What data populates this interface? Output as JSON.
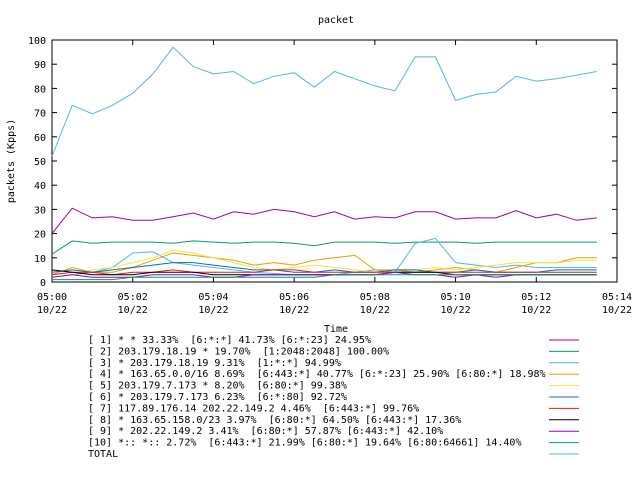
{
  "chart_data": {
    "type": "line",
    "title": "packet",
    "xlabel": "Time",
    "ylabel": "packets (Kpps)",
    "ylim": [
      0,
      100
    ],
    "y_ticks": [
      "0",
      "10",
      "20",
      "30",
      "40",
      "50",
      "60",
      "70",
      "80",
      "90",
      "100"
    ],
    "x_ticks": [
      {
        "time": "05:00",
        "date": "10/22"
      },
      {
        "time": "05:02",
        "date": "10/22"
      },
      {
        "time": "05:04",
        "date": "10/22"
      },
      {
        "time": "05:06",
        "date": "10/22"
      },
      {
        "time": "05:08",
        "date": "10/22"
      },
      {
        "time": "05:10",
        "date": "10/22"
      },
      {
        "time": "05:12",
        "date": "10/22"
      },
      {
        "time": "05:14",
        "date": "10/22"
      }
    ],
    "x": [
      "05:00",
      "05:00:30",
      "05:01",
      "05:01:30",
      "05:02",
      "05:02:30",
      "05:03",
      "05:03:30",
      "05:04",
      "05:04:30",
      "05:05",
      "05:05:30",
      "05:06",
      "05:06:30",
      "05:07",
      "05:07:30",
      "05:08",
      "05:08:30",
      "05:09",
      "05:09:30",
      "05:10",
      "05:10:30",
      "05:11",
      "05:11:30",
      "05:12",
      "05:12:30",
      "05:13",
      "05:13:30"
    ],
    "grid": false,
    "legend_position": "bottom",
    "series": [
      {
        "name": "[ 1] * * 33.33%  [6:*:*] 41.73% [6:*:23] 24.95%",
        "color": "#a000a0",
        "values": [
          20,
          30.5,
          26.5,
          27,
          25.5,
          25.5,
          27,
          28.5,
          26,
          29,
          28,
          30,
          29,
          27,
          29,
          26,
          27,
          26.5,
          29,
          29,
          26,
          26.5,
          26.5,
          29.5,
          26.5,
          28,
          25.5,
          26.5
        ]
      },
      {
        "name": "[ 2] 203.179.18.19 * 19.70%  [1:2048:2048] 100.00%",
        "color": "#00a060",
        "values": [
          11.5,
          17,
          16,
          16.5,
          16.5,
          16.5,
          16,
          17,
          16.5,
          16,
          16.5,
          16.5,
          16,
          15,
          16.5,
          16.5,
          16.5,
          16,
          16.5,
          16.5,
          16.5,
          16,
          16.5,
          16.5,
          16.5,
          16.5,
          16.5,
          16.5
        ]
      },
      {
        "name": "[ 3] * 203.179.18.19 9.31%  [1:*:*] 94.99%",
        "color": "#56b4e9",
        "values": [
          2,
          3,
          4,
          6,
          12,
          12.5,
          8,
          7,
          6,
          5,
          4,
          3.5,
          3,
          3,
          3,
          4,
          5,
          4,
          16,
          18,
          8,
          7,
          6,
          7,
          6,
          6,
          6,
          6
        ]
      },
      {
        "name": "[ 4] * 163.65.0.0/16 8.69%  [6:443:*] 40.77% [6:*:23] 25.90% [6:80:*] 18.98%",
        "color": "#e69f00",
        "values": [
          3,
          6,
          4,
          4,
          6,
          9,
          12,
          11,
          10,
          9,
          7,
          8,
          7,
          9,
          10,
          11,
          5,
          5,
          4,
          5,
          6,
          5,
          4,
          6,
          8,
          8,
          10,
          10
        ]
      },
      {
        "name": "[ 5] 203.179.7.173 * 8.20%  [6:80:*] 99.38%",
        "color": "#f0e442",
        "values": [
          2,
          3,
          5,
          6,
          8,
          10,
          13,
          12,
          10,
          8,
          6,
          5,
          6,
          7,
          6,
          5,
          4,
          5,
          5,
          6,
          5,
          6,
          7,
          8,
          8,
          8,
          9,
          9
        ]
      },
      {
        "name": "[ 6] * 203.179.7.173 6.23%  [6:*:80] 92.72%",
        "color": "#0072b2",
        "values": [
          4,
          5,
          4,
          5,
          6,
          7,
          8,
          8,
          7,
          6,
          5,
          5,
          4,
          4,
          5,
          4,
          4,
          5,
          5,
          4,
          4,
          5,
          4,
          4,
          4,
          5,
          5,
          5
        ]
      },
      {
        "name": "[ 7] 117.89.176.14 202.22.149.2 4.46%  [6:443:*] 99.76%",
        "color": "#e51e10",
        "values": [
          3,
          4,
          4,
          3,
          4,
          4,
          5,
          4,
          4,
          4,
          4,
          5,
          5,
          4,
          4,
          4,
          4,
          4,
          4,
          4,
          4,
          4,
          4,
          4,
          4,
          4,
          4,
          4
        ]
      },
      {
        "name": "[ 8] * 163.65.158.0/23 3.97%  [6:80:*] 64.50% [6:443:*] 17.36%",
        "color": "#000000",
        "values": [
          5,
          4,
          3,
          3,
          3,
          4,
          4,
          4,
          3,
          3,
          3,
          3,
          3,
          3,
          3,
          3,
          3,
          4,
          4,
          4,
          3,
          3,
          3,
          3,
          3,
          3,
          3,
          3
        ]
      },
      {
        "name": "[ 9] * 202.22.149.2 3.41%  [6:80:*] 57.87% [6:443:*] 42.10%",
        "color": "#9400d3",
        "values": [
          2,
          3,
          2,
          2,
          2,
          3,
          3,
          3,
          2,
          2,
          3,
          3,
          3,
          3,
          3,
          3,
          3,
          4,
          3,
          3,
          2,
          3,
          2,
          3,
          3,
          3,
          3,
          3
        ]
      },
      {
        "name": "[10] *:: *:: 2.72%  [6:443:*] 21.99% [6:80:*] 19.64% [6:80:64661] 14.40%",
        "color": "#009e73",
        "values": [
          1,
          1,
          1,
          1,
          2,
          2,
          2,
          2,
          2,
          2,
          2,
          2,
          2,
          2,
          3,
          3,
          3,
          3,
          3,
          3,
          3,
          3,
          3,
          3,
          3,
          3,
          3,
          3
        ]
      },
      {
        "name": "TOTAL",
        "color": "#56b4e9",
        "values": [
          52,
          73,
          69.5,
          73,
          78,
          86,
          97,
          89,
          86,
          87,
          82,
          85,
          86.5,
          80.5,
          87,
          84,
          81,
          79,
          93,
          93,
          75,
          77.5,
          78.5,
          85,
          83,
          84,
          85.5,
          87
        ]
      }
    ]
  }
}
